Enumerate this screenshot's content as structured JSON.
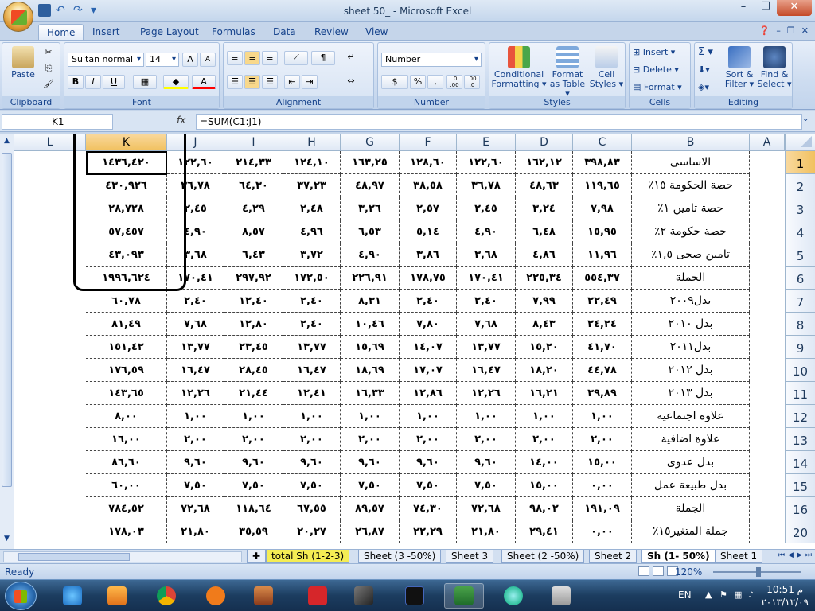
{
  "window": {
    "title": "sheet 50_ - Microsoft Excel"
  },
  "ribbon_tabs": [
    "Home",
    "Insert",
    "Page Layout",
    "Formulas",
    "Data",
    "Review",
    "View"
  ],
  "active_tab": "Home",
  "clipboard": {
    "paste": "Paste",
    "label": "Clipboard"
  },
  "font": {
    "name": "Sultan normal",
    "size": "14",
    "label": "Font",
    "bold": "B",
    "italic": "I",
    "underline": "U",
    "grow": "A",
    "shrink": "A",
    "font_color": "A"
  },
  "alignment": {
    "label": "Alignment"
  },
  "number": {
    "format": "Number",
    "label": "Number",
    "percent": "%",
    "comma": ",",
    "inc": ".0 .00",
    "dec": ".00 .0"
  },
  "styles": {
    "conditional": "Conditional Formatting ▾",
    "table": "Format as Table ▾",
    "cell": "Cell Styles ▾",
    "label": "Styles"
  },
  "cells": {
    "insert": "Insert ▾",
    "delete": "Delete ▾",
    "format": "Format ▾",
    "label": "Cells"
  },
  "editing": {
    "sum": "Σ ▾",
    "sort": "Sort & Filter ▾",
    "find": "Find & Select ▾",
    "label": "Editing"
  },
  "formula_bar": {
    "name_box": "K1",
    "fx": "fx",
    "formula": "=SUM(C1:J1)"
  },
  "columns": [
    "L",
    "K",
    "J",
    "I",
    "H",
    "G",
    "F",
    "E",
    "D",
    "C",
    "B",
    "A"
  ],
  "selected_column": "K",
  "rows": [
    {
      "num": "1",
      "B": "الاساسى",
      "C": "٣٩٨,٨٣",
      "D": "١٦٢,١٢",
      "E": "١٢٢,٦٠",
      "F": "١٢٨,٦٠",
      "G": "١٦٣,٢٥",
      "H": "١٢٤,١٠",
      "I": "٢١٤,٣٣",
      "J": "١٢٢,٦٠",
      "K": "١٤٣٦,٤٢٠"
    },
    {
      "num": "2",
      "B": "حصة الحكومة ١٥٪",
      "C": "١١٩,٦٥",
      "D": "٤٨,٦٣",
      "E": "٣٦,٧٨",
      "F": "٣٨,٥٨",
      "G": "٤٨,٩٧",
      "H": "٣٧,٢٣",
      "I": "٦٤,٣٠",
      "J": "٣٦,٧٨",
      "K": "٤٣٠,٩٢٦"
    },
    {
      "num": "3",
      "B": "حصة تامين ١٪",
      "C": "٧,٩٨",
      "D": "٣,٢٤",
      "E": "٢,٤٥",
      "F": "٢,٥٧",
      "G": "٣,٢٦",
      "H": "٢,٤٨",
      "I": "٤,٢٩",
      "J": "٢,٤٥",
      "K": "٢٨,٧٢٨"
    },
    {
      "num": "4",
      "B": "حصة حكومة ٢٪",
      "C": "١٥,٩٥",
      "D": "٦,٤٨",
      "E": "٤,٩٠",
      "F": "٥,١٤",
      "G": "٦,٥٣",
      "H": "٤,٩٦",
      "I": "٨,٥٧",
      "J": "٤,٩٠",
      "K": "٥٧,٤٥٧"
    },
    {
      "num": "5",
      "B": "تامين صحى ١,٥٪",
      "C": "١١,٩٦",
      "D": "٤,٨٦",
      "E": "٣,٦٨",
      "F": "٣,٨٦",
      "G": "٤,٩٠",
      "H": "٣,٧٢",
      "I": "٦,٤٣",
      "J": "٣,٦٨",
      "K": "٤٣,٠٩٣"
    },
    {
      "num": "6",
      "B": "الجملة",
      "C": "٥٥٤,٣٧",
      "D": "٢٢٥,٣٤",
      "E": "١٧٠,٤١",
      "F": "١٧٨,٧٥",
      "G": "٢٢٦,٩١",
      "H": "١٧٢,٥٠",
      "I": "٢٩٧,٩٢",
      "J": "١٧٠,٤١",
      "K": "١٩٩٦,٦٢٤"
    },
    {
      "num": "7",
      "B": "بدل٢٠٠٩",
      "C": "٢٢,٤٩",
      "D": "٧,٩٩",
      "E": "٢,٤٠",
      "F": "٢,٤٠",
      "G": "٨,٣١",
      "H": "٢,٤٠",
      "I": "١٢,٤٠",
      "J": "٢,٤٠",
      "K": "٦٠,٧٨"
    },
    {
      "num": "8",
      "B": "بدل ٢٠١٠",
      "C": "٢٤,٢٤",
      "D": "٨,٤٣",
      "E": "٧,٦٨",
      "F": "٧,٨٠",
      "G": "١٠,٤٦",
      "H": "٢,٤٠",
      "I": "١٢,٨٠",
      "J": "٧,٦٨",
      "K": "٨١,٤٩"
    },
    {
      "num": "9",
      "B": "بدل٢٠١١",
      "C": "٤١,٧٠",
      "D": "١٥,٢٠",
      "E": "١٣,٧٧",
      "F": "١٤,٠٧",
      "G": "١٥,٦٩",
      "H": "١٣,٧٧",
      "I": "٢٣,٤٥",
      "J": "١٣,٧٧",
      "K": "١٥١,٤٢"
    },
    {
      "num": "10",
      "B": "بدل ٢٠١٢",
      "C": "٤٤,٧٨",
      "D": "١٨,٢٠",
      "E": "١٦,٤٧",
      "F": "١٧,٠٧",
      "G": "١٨,٦٩",
      "H": "١٦,٤٧",
      "I": "٢٨,٤٥",
      "J": "١٦,٤٧",
      "K": "١٧٦,٥٩"
    },
    {
      "num": "11",
      "B": "بدل ٢٠١٣",
      "C": "٣٩,٨٩",
      "D": "١٦,٢١",
      "E": "١٢,٢٦",
      "F": "١٢,٨٦",
      "G": "١٦,٣٣",
      "H": "١٢,٤١",
      "I": "٢١,٤٤",
      "J": "١٢,٢٦",
      "K": "١٤٣,٦٥"
    },
    {
      "num": "12",
      "B": "علاوة اجتماعية",
      "C": "١,٠٠",
      "D": "١,٠٠",
      "E": "١,٠٠",
      "F": "١,٠٠",
      "G": "١,٠٠",
      "H": "١,٠٠",
      "I": "١,٠٠",
      "J": "١,٠٠",
      "K": "٨,٠٠"
    },
    {
      "num": "13",
      "B": "علاوة اضافية",
      "C": "٢,٠٠",
      "D": "٢,٠٠",
      "E": "٢,٠٠",
      "F": "٢,٠٠",
      "G": "٢,٠٠",
      "H": "٢,٠٠",
      "I": "٢,٠٠",
      "J": "٢,٠٠",
      "K": "١٦,٠٠"
    },
    {
      "num": "14",
      "B": "بدل عدوى",
      "C": "١٥,٠٠",
      "D": "١٤,٠٠",
      "E": "٩,٦٠",
      "F": "٩,٦٠",
      "G": "٩,٦٠",
      "H": "٩,٦٠",
      "I": "٩,٦٠",
      "J": "٩,٦٠",
      "K": "٨٦,٦٠"
    },
    {
      "num": "15",
      "B": "بدل طبيعة عمل",
      "C": "٠,٠٠",
      "D": "١٥,٠٠",
      "E": "٧,٥٠",
      "F": "٧,٥٠",
      "G": "٧,٥٠",
      "H": "٧,٥٠",
      "I": "٧,٥٠",
      "J": "٧,٥٠",
      "K": "٦٠,٠٠"
    },
    {
      "num": "16",
      "B": "الجملة",
      "C": "١٩١,٠٩",
      "D": "٩٨,٠٢",
      "E": "٧٢,٦٨",
      "F": "٧٤,٣٠",
      "G": "٨٩,٥٧",
      "H": "٦٧,٥٥",
      "I": "١١٨,٦٤",
      "J": "٧٢,٦٨",
      "K": "٧٨٤,٥٢"
    },
    {
      "num": "20",
      "B": "جملة المتغير١٥٪",
      "C": "٠,٠٠",
      "D": "٢٩,٤١",
      "E": "٢١,٨٠",
      "F": "٢٢,٢٩",
      "G": "٢٦,٨٧",
      "H": "٢٠,٢٧",
      "I": "٣٥,٥٩",
      "J": "٢١,٨٠",
      "K": "١٧٨,٠٣"
    }
  ],
  "sheet_tabs": [
    "total Sh (1-2-3)",
    "Sheet (3 -50%)",
    "Sheet 3",
    "Sheet (2 -50%)",
    "Sheet 2",
    "Sh (1- 50%)",
    "Sheet 1"
  ],
  "active_sheet": "Sh (1- 50%)",
  "status": {
    "ready": "Ready",
    "zoom": "120%"
  },
  "taskbar": {
    "lang": "EN",
    "time": "10:51 م",
    "date": "٢٠١٣/١٢/٠٩"
  }
}
